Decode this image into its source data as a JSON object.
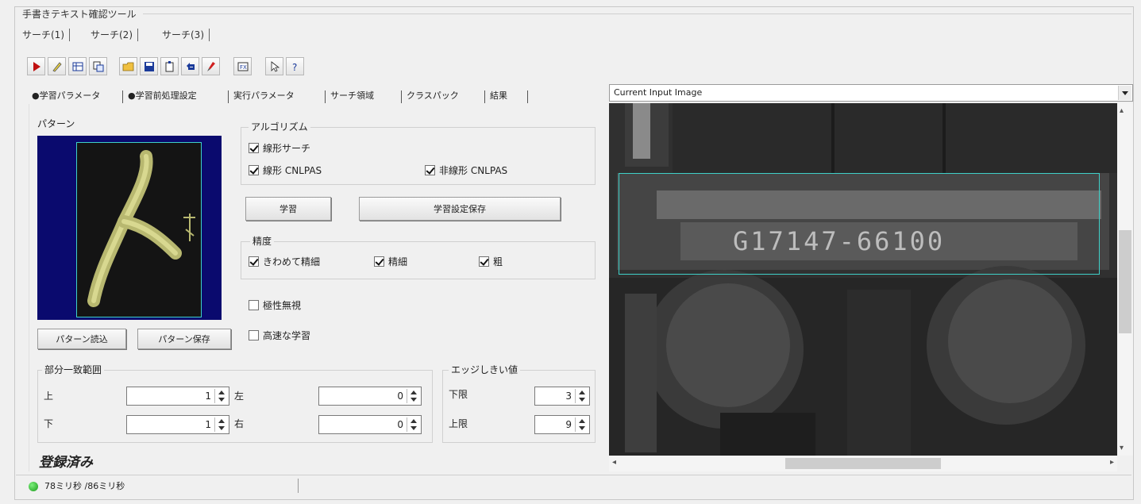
{
  "window": {
    "title": "手書きテキスト確認ツール"
  },
  "search_tabs": [
    "サーチ(1)",
    "サーチ(2)",
    "サーチ(3)"
  ],
  "toolbar": {
    "buttons": [
      "run-icon",
      "pen-icon",
      "grid-icon",
      "copy-icon",
      "open-folder-icon",
      "save-icon",
      "paste-icon",
      "undo-icon",
      "brush-icon",
      "fit-icon",
      "cursor-icon",
      "help-icon"
    ]
  },
  "tabs": [
    "●学習パラメータ",
    "●学習前処理設定",
    "実行パラメータ",
    "サーチ領域",
    "クラスパック",
    "結果"
  ],
  "pattern": {
    "label": "パターン",
    "btn_load": "パターン読込",
    "btn_save": "パターン保存"
  },
  "algorithm": {
    "label": "アルゴリズム",
    "linear_search": "線形サーチ",
    "linear_cnlpas": "線形 CNLPAS",
    "nonlinear_cnlpas": "非線形 CNLPAS",
    "linear_search_checked": true,
    "linear_cnlpas_checked": true,
    "nonlinear_cnlpas_checked": true
  },
  "buttons": {
    "learn": "学習",
    "learn_settings": "学習設定保存"
  },
  "precision": {
    "label": "精度",
    "very_fine": "きわめて精細",
    "fine": "精細",
    "coarse": "粗",
    "very_fine_checked": true,
    "fine_checked": true,
    "coarse_checked": true
  },
  "options": {
    "polarity": "極性無視",
    "high_speed": "高速な学習",
    "polarity_checked": false,
    "high_speed_checked": false
  },
  "partial_match": {
    "label": "部分一致範囲",
    "up": "上",
    "down": "下",
    "left": "左",
    "right": "右",
    "up_value": "1",
    "down_value": "1",
    "left_value": "0",
    "right_value": "0"
  },
  "edge_threshold": {
    "label": "エッジしきい値",
    "lower": "下限",
    "upper": "上限",
    "lower_value": "3",
    "upper_value": "9"
  },
  "status": {
    "registered": "登録済み",
    "times": "78ミリ秒 /86ミリ秒"
  },
  "image_view": {
    "source": "Current Input Image",
    "plate_text": "G17147-66100"
  },
  "colors": {
    "pattern_bg": "#0a0a6e",
    "roi": "#3fd0c8",
    "status_ok": "#22aa22"
  }
}
